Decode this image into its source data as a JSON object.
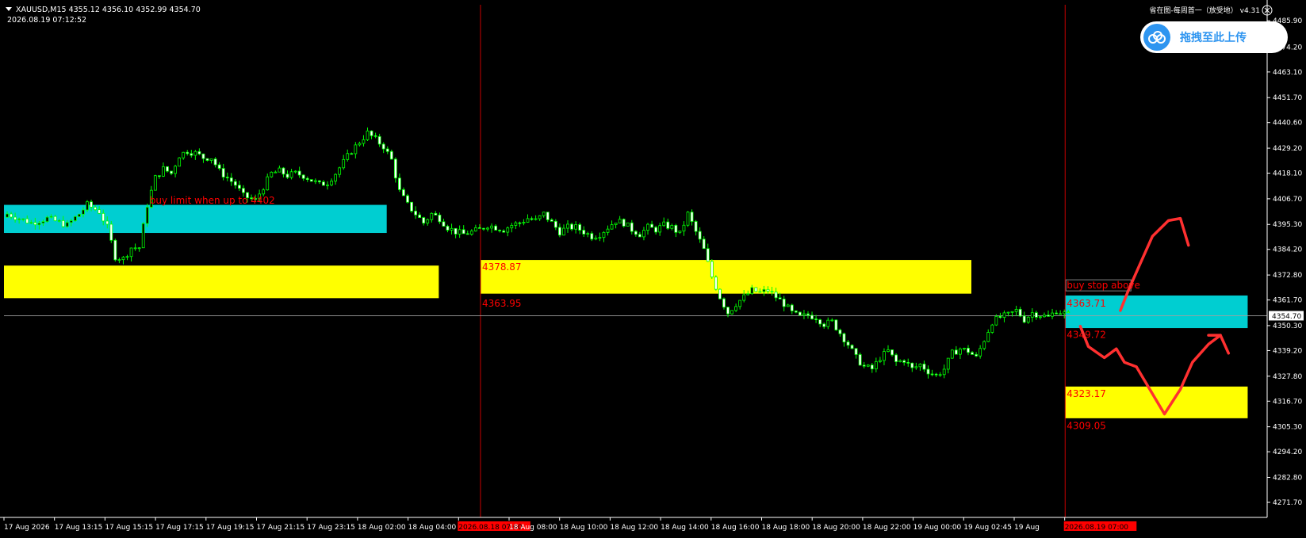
{
  "header": {
    "symbol_line": "XAUUSD,M15  4355.12 4356.10 4352.99 4354.70",
    "datetime": "2026.08.19 07:12:52",
    "indicator": "省在图-每周首一（放受地） v4.31"
  },
  "upload_widget": {
    "label": "拖拽至此上传",
    "icon": "cloud-upload-icon"
  },
  "colors": {
    "background": "#000000",
    "bull_candle": "#00ff00",
    "bear_candle": "#ffffff",
    "cyan_zone": "#00ced1",
    "yellow_zone": "#ffff00",
    "annotation_red": "#ff0000",
    "vline_red": "#c80000",
    "axis": "#ffffff",
    "current_price_line": "#a0a0a0"
  },
  "chart_data": {
    "type": "candlestick",
    "symbol": "XAUUSD",
    "timeframe": "M15",
    "ylim": [
      4265.0,
      4493.0
    ],
    "y_ticks": [
      "4485.90",
      "4474.20",
      "4463.10",
      "4451.70",
      "4440.60",
      "4429.20",
      "4418.10",
      "4406.70",
      "4395.30",
      "4384.20",
      "4372.80",
      "4361.70",
      "4350.30",
      "4339.20",
      "4327.80",
      "4316.70",
      "4305.30",
      "4294.20",
      "4282.80",
      "4271.70"
    ],
    "current_price": "4354.70",
    "x_ticks": [
      "17 Aug 2026",
      "17 Aug 13:15",
      "17 Aug 15:15",
      "17 Aug 17:15",
      "17 Aug 19:15",
      "17 Aug 21:15",
      "17 Aug 23:15",
      "18 Aug 02:00",
      "18 Aug 04:00",
      "2026.08.18 07:00",
      "18 Aug 08:00",
      "18 Aug 10:00",
      "18 Aug 12:00",
      "18 Aug 14:00",
      "18 Aug 16:00",
      "18 Aug 18:00",
      "18 Aug 20:00",
      "18 Aug 22:00",
      "19 Aug 00:00",
      "19 Aug 02:45",
      "19 Aug",
      "2026.08.19 07:00"
    ],
    "x_tick_highlight": [
      false,
      false,
      false,
      false,
      false,
      false,
      false,
      false,
      false,
      true,
      false,
      false,
      false,
      false,
      false,
      false,
      false,
      false,
      false,
      false,
      false,
      true
    ],
    "close_path": [
      [
        0,
        4400
      ],
      [
        6,
        4396
      ],
      [
        10,
        4398
      ],
      [
        15,
        4395
      ],
      [
        18,
        4400
      ],
      [
        20,
        4404
      ],
      [
        23,
        4401
      ],
      [
        25,
        4394
      ],
      [
        27,
        4381
      ],
      [
        29,
        4380
      ],
      [
        31,
        4385
      ],
      [
        33,
        4385
      ],
      [
        35,
        4404
      ],
      [
        37,
        4416
      ],
      [
        39,
        4420
      ],
      [
        41,
        4418
      ],
      [
        43,
        4426
      ],
      [
        45,
        4428
      ],
      [
        47,
        4427
      ],
      [
        49,
        4425
      ],
      [
        51,
        4425
      ],
      [
        53,
        4419
      ],
      [
        55,
        4416
      ],
      [
        57,
        4413
      ],
      [
        59,
        4408
      ],
      [
        62,
        4406
      ],
      [
        64,
        4412
      ],
      [
        66,
        4418
      ],
      [
        68,
        4419
      ],
      [
        70,
        4417
      ],
      [
        72,
        4418
      ],
      [
        74,
        4417
      ],
      [
        76,
        4415
      ],
      [
        78,
        4413
      ],
      [
        80,
        4414
      ],
      [
        82,
        4418
      ],
      [
        84,
        4423
      ],
      [
        86,
        4428
      ],
      [
        88,
        4432
      ],
      [
        90,
        4436
      ],
      [
        92,
        4433
      ],
      [
        94,
        4430
      ],
      [
        96,
        4424
      ],
      [
        98,
        4410
      ],
      [
        100,
        4404
      ],
      [
        102,
        4400
      ],
      [
        104,
        4396
      ],
      [
        106,
        4400
      ],
      [
        108,
        4398
      ],
      [
        110,
        4394
      ],
      [
        112,
        4392
      ],
      [
        114,
        4391
      ],
      [
        116,
        4392
      ],
      [
        118,
        4393
      ],
      [
        120,
        4395
      ],
      [
        122,
        4394
      ],
      [
        124,
        4393
      ],
      [
        126,
        4395
      ],
      [
        128,
        4396
      ],
      [
        130,
        4398
      ],
      [
        132,
        4397
      ],
      [
        134,
        4400
      ],
      [
        136,
        4396
      ],
      [
        138,
        4392
      ],
      [
        140,
        4394
      ],
      [
        142,
        4394
      ],
      [
        144,
        4392
      ],
      [
        146,
        4390
      ],
      [
        148,
        4391
      ],
      [
        150,
        4394
      ],
      [
        152,
        4397
      ],
      [
        154,
        4396
      ],
      [
        156,
        4393
      ],
      [
        158,
        4391
      ],
      [
        160,
        4394
      ],
      [
        162,
        4393
      ],
      [
        164,
        4395
      ],
      [
        166,
        4394
      ],
      [
        168,
        4391
      ],
      [
        170,
        4400
      ],
      [
        172,
        4392
      ],
      [
        174,
        4384
      ],
      [
        176,
        4372
      ],
      [
        178,
        4363
      ],
      [
        180,
        4356
      ],
      [
        182,
        4360
      ],
      [
        184,
        4363
      ],
      [
        186,
        4366
      ],
      [
        188,
        4365
      ],
      [
        190,
        4366
      ],
      [
        192,
        4363
      ],
      [
        194,
        4360
      ],
      [
        196,
        4356
      ],
      [
        198,
        4354
      ],
      [
        200,
        4355
      ],
      [
        202,
        4354
      ],
      [
        204,
        4351
      ],
      [
        206,
        4352
      ],
      [
        208,
        4347
      ],
      [
        210,
        4342
      ],
      [
        212,
        4336
      ],
      [
        214,
        4332
      ],
      [
        216,
        4331
      ],
      [
        218,
        4336
      ],
      [
        220,
        4339
      ],
      [
        222,
        4334
      ],
      [
        224,
        4335
      ],
      [
        226,
        4331
      ],
      [
        228,
        4333
      ],
      [
        230,
        4330
      ],
      [
        232,
        4328
      ],
      [
        234,
        4331
      ],
      [
        236,
        4338
      ],
      [
        238,
        4340
      ],
      [
        240,
        4339
      ],
      [
        242,
        4336
      ],
      [
        244,
        4344
      ],
      [
        246,
        4352
      ],
      [
        248,
        4354
      ],
      [
        250,
        4355
      ],
      [
        252,
        4357
      ],
      [
        254,
        4353
      ],
      [
        256,
        4356
      ],
      [
        258,
        4355
      ],
      [
        260,
        4354
      ],
      [
        262,
        4357
      ],
      [
        265,
        4355
      ]
    ],
    "candle_count": 266,
    "zones": [
      {
        "color": "cyan",
        "left_bar": 0,
        "right_bar": 94,
        "top": 4404.0,
        "bottom": 4391.5
      },
      {
        "color": "yellow",
        "left_bar": 0,
        "right_bar": 107,
        "top": 4377.0,
        "bottom": 4362.5
      },
      {
        "color": "yellow",
        "left_bar": 119,
        "right_bar": 240,
        "top": 4379.5,
        "bottom": 4364.5
      },
      {
        "color": "cyan",
        "left_bar": 265,
        "right_bar": 309,
        "top": 4363.7,
        "bottom": 4349.2
      },
      {
        "color": "yellow",
        "left_bar": 265,
        "right_bar": 309,
        "top": 4323.2,
        "bottom": 4309.1
      }
    ],
    "vertical_lines": [
      {
        "bar": 119
      },
      {
        "bar": 265
      }
    ],
    "annotations": [
      {
        "text": "buy limit when up to 4402",
        "bar": 36,
        "price": 4404.5
      },
      {
        "text": "4378.87",
        "bar": 119,
        "price": 4375.0
      },
      {
        "text": "4363.95",
        "bar": 119,
        "price": 4358.7
      },
      {
        "text": "buy stop above",
        "bar": 265,
        "price": 4366.8,
        "boxed": true
      },
      {
        "text": "4363.71",
        "bar": 265,
        "price": 4358.8
      },
      {
        "text": "4349.72",
        "bar": 265,
        "price": 4344.8
      },
      {
        "text": "4323.17",
        "bar": 265,
        "price": 4318.6
      },
      {
        "text": "4309.05",
        "bar": 265,
        "price": 4304.3
      }
    ],
    "freehand_arrows": [
      [
        [
          278,
          4357
        ],
        [
          280,
          4366
        ],
        [
          283,
          4378
        ],
        [
          286,
          4390
        ],
        [
          290,
          4397
        ],
        [
          293,
          4398
        ],
        [
          294,
          4392
        ],
        [
          295,
          4386
        ]
      ],
      [
        [
          268,
          4350
        ],
        [
          270,
          4341
        ],
        [
          274,
          4336
        ],
        [
          277,
          4340
        ],
        [
          279,
          4334
        ],
        [
          282,
          4332
        ],
        [
          286,
          4320
        ],
        [
          289,
          4311
        ],
        [
          293,
          4322
        ],
        [
          296,
          4334
        ],
        [
          300,
          4342
        ],
        [
          303,
          4346
        ],
        [
          305,
          4338
        ]
      ],
      [
        [
          300,
          4346
        ],
        [
          303,
          4346
        ]
      ]
    ]
  }
}
